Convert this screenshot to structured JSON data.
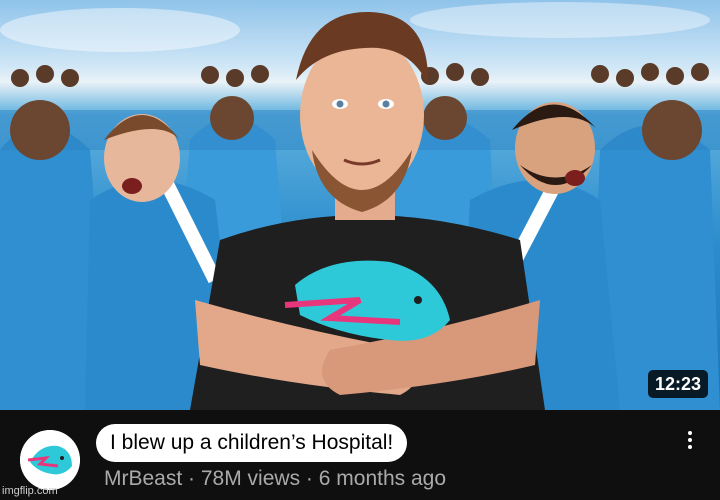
{
  "thumbnail": {
    "duration": "12:23"
  },
  "video": {
    "title": "I blew up a children’s Hospital!",
    "channel": "MrBeast",
    "views": "78M views",
    "age": "6 months ago",
    "separator": "·"
  },
  "icons": {
    "avatar": "mrbeast-panther-logo",
    "menu": "more-vertical-icon",
    "shirt_logo": "panther-logo"
  },
  "watermark": "imgflip.com",
  "colors": {
    "background": "#0f0f0f",
    "title_bg": "#ffffff",
    "meta_text": "#aaaaaa",
    "tracksuit": "#2b8ccc",
    "logo_cyan": "#2ec9d8",
    "logo_pink": "#e8367d"
  }
}
